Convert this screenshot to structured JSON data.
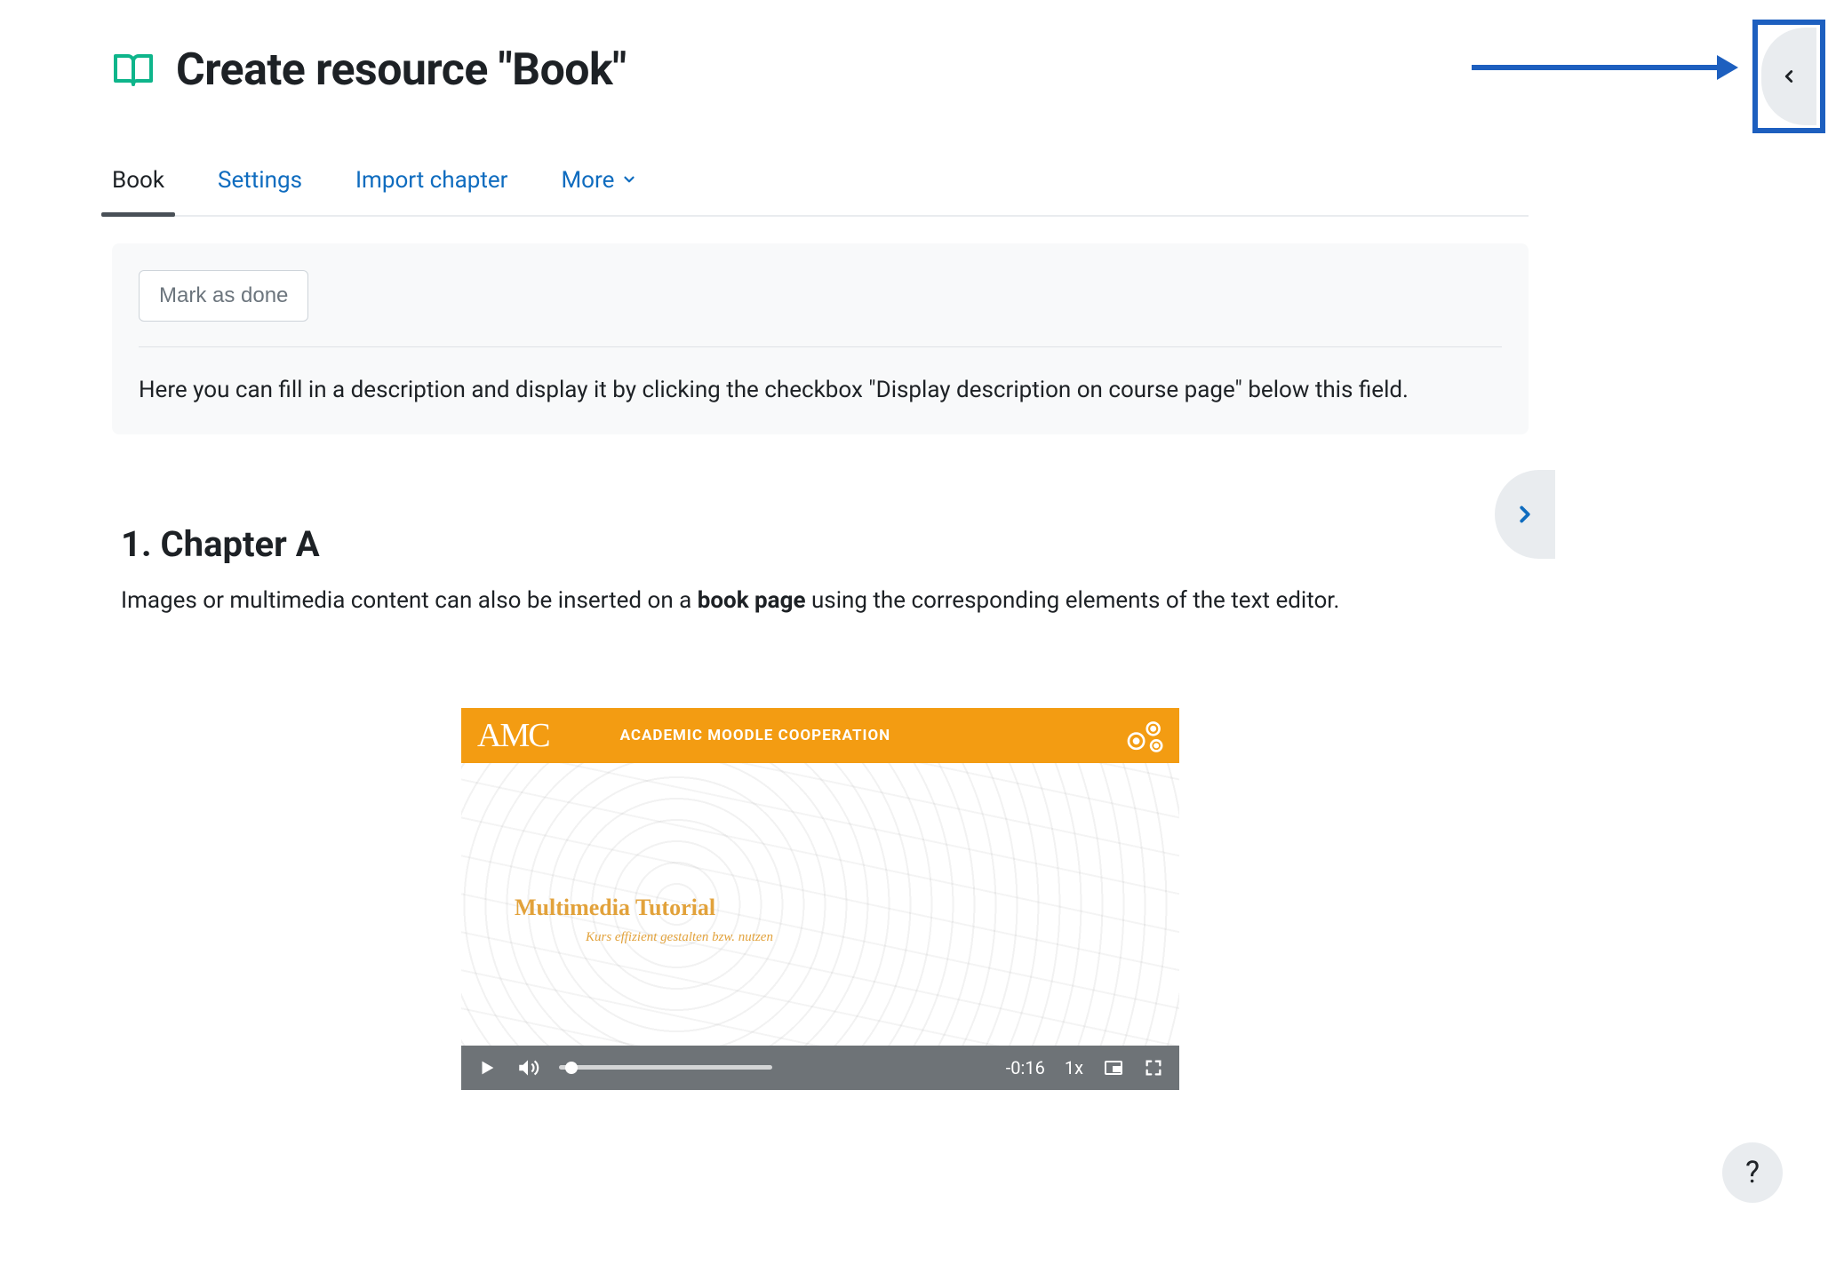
{
  "header": {
    "title": "Create resource \"Book\"",
    "icon": "book-icon"
  },
  "tabs": {
    "book": "Book",
    "settings": "Settings",
    "import": "Import chapter",
    "more": "More"
  },
  "card": {
    "mark_done": "Mark as done",
    "description": "Here you can fill in a description and display it by clicking the checkbox \"Display description on course page\" below this field."
  },
  "chapter": {
    "title": "1. Chapter A",
    "body_pre": "Images or multimedia content can also be inserted on a ",
    "body_bold": "book page",
    "body_post": " using the corresponding elements of the text editor."
  },
  "video": {
    "logo": "AMC",
    "header_text": "ACADEMIC MOODLE COOPERATION",
    "title": "Multimedia Tutorial",
    "subtitle": "Kurs effizient gestalten bzw. nutzen",
    "time": "-0:16",
    "rate": "1x"
  },
  "help": {
    "label": "?"
  }
}
